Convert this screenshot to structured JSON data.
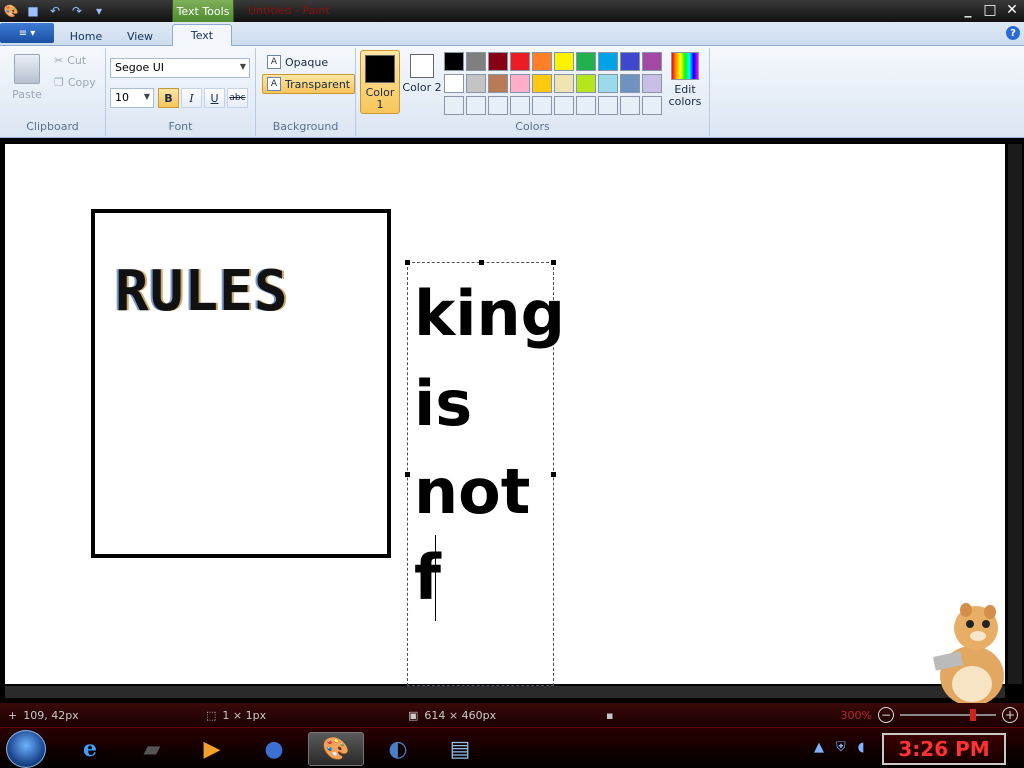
{
  "titlebar": {
    "context_tab": "Text Tools",
    "title": "Untitled - Paint",
    "controls": [
      "_",
      "□",
      "✕"
    ]
  },
  "tabs": {
    "app_menu": "≡ ▾",
    "items": [
      {
        "label": "Home"
      },
      {
        "label": "View"
      },
      {
        "label": "Text"
      }
    ],
    "help": "?"
  },
  "clipboard": {
    "paste": "Paste",
    "cut": "Cut",
    "copy": "Copy",
    "label": "Clipboard"
  },
  "font": {
    "family": "Segoe UI",
    "size": "10",
    "bold": "B",
    "italic": "I",
    "underline": "U",
    "strike": "abc",
    "label": "Font"
  },
  "background": {
    "opaque": "Opaque",
    "transparent": "Transparent",
    "label": "Background"
  },
  "colors": {
    "color1": "Color 1",
    "color2": "Color 2",
    "edit": "Edit colors",
    "label": "Colors",
    "color1_value": "#000000",
    "color2_value": "#ffffff",
    "palette": [
      "#000000",
      "#7f7f7f",
      "#880015",
      "#ed1c24",
      "#ff7f27",
      "#fff200",
      "#22b14c",
      "#00a2e8",
      "#3f48cc",
      "#a349a4",
      "#ffffff",
      "#c3c3c3",
      "#b97a57",
      "#ffaec9",
      "#ffc90e",
      "#efe4b0",
      "#b5e61d",
      "#99d9ea",
      "#7092be",
      "#c8bfe7",
      "#e6eef8",
      "#e6eef8",
      "#e6eef8",
      "#e6eef8",
      "#e6eef8",
      "#e6eef8",
      "#e6eef8",
      "#e6eef8",
      "#e6eef8",
      "#e6eef8"
    ]
  },
  "canvas": {
    "rules_text": "RULES",
    "textbox_lines": [
      "king",
      "is",
      "not",
      "f"
    ]
  },
  "statusbar": {
    "position": "109, 42px",
    "selection": "1 × 1px",
    "canvas_size": "614 × 460px",
    "zoom": "300%",
    "zoom_out": "−",
    "zoom_in": "+"
  },
  "taskbar": {
    "clock": "3:26 PM"
  }
}
